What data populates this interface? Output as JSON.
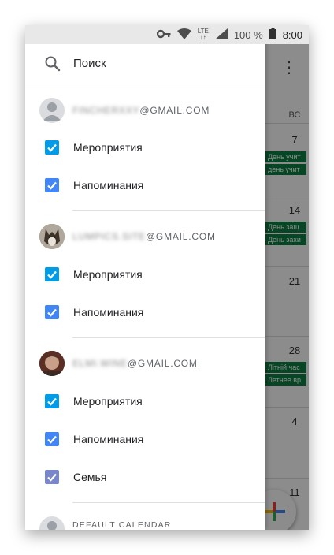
{
  "status_bar": {
    "lte": "LTE",
    "battery": "100 %",
    "time": "8:00"
  },
  "calendar_bg": {
    "weekday": "ВС",
    "days": [
      "7",
      "14",
      "21",
      "28",
      "4",
      "11"
    ],
    "events": {
      "w1": [
        "День учит",
        "день учит"
      ],
      "w2": [
        "День защ",
        "День захи"
      ],
      "w4": [
        "Літній час",
        "Летнее вр"
      ]
    }
  },
  "drawer": {
    "search_label": "Поиск",
    "accounts": [
      {
        "email_hidden": "FINCHERXXY",
        "email_domain": "@GMAIL.COM",
        "calendars": [
          {
            "label": "Мероприятия",
            "color": "#039be5",
            "checked": true
          },
          {
            "label": "Напоминания",
            "color": "#4285f4",
            "checked": true
          }
        ]
      },
      {
        "email_hidden": "LUMPICS.SITE",
        "email_domain": "@GMAIL.COM",
        "calendars": [
          {
            "label": "Мероприятия",
            "color": "#039be5",
            "checked": true
          },
          {
            "label": "Напоминания",
            "color": "#4285f4",
            "checked": true
          }
        ]
      },
      {
        "email_hidden": "ELMI.WINE",
        "email_domain": "@GMAIL.COM",
        "calendars": [
          {
            "label": "Мероприятия",
            "color": "#039be5",
            "checked": true
          },
          {
            "label": "Напоминания",
            "color": "#4285f4",
            "checked": true
          },
          {
            "label": "Семья",
            "color": "#7986cb",
            "checked": true
          }
        ]
      }
    ],
    "default_calendar_label": "DEFAULT CALENDAR"
  }
}
